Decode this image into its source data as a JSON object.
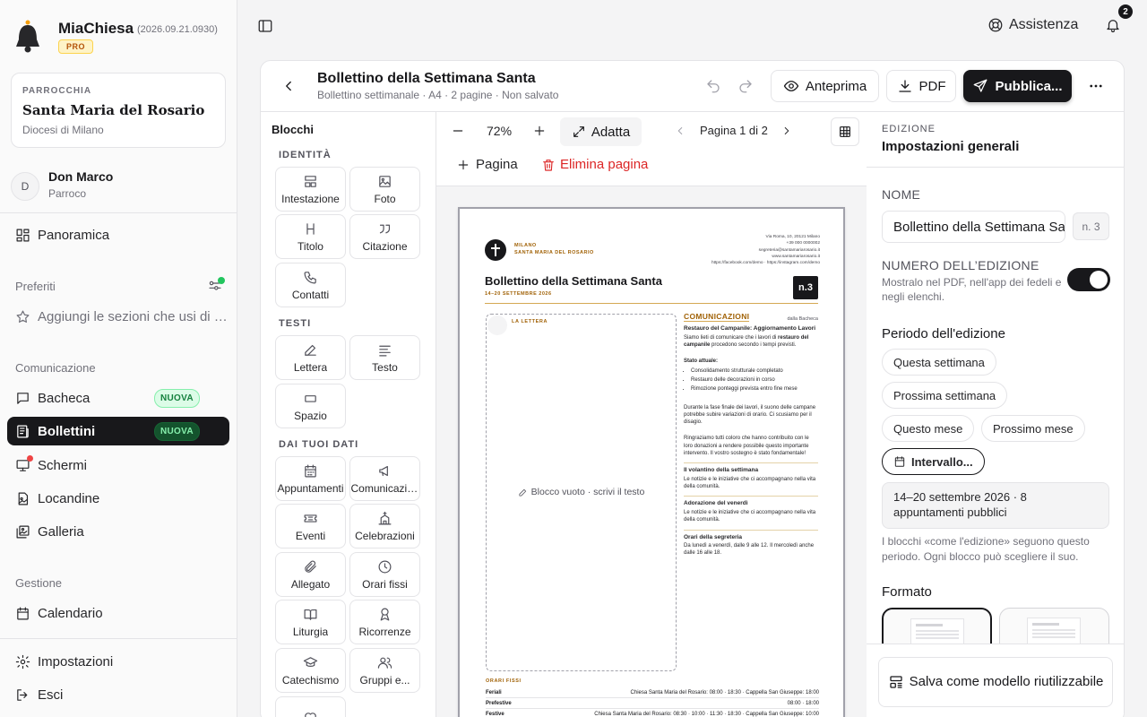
{
  "app": {
    "name": "MiaChiesa",
    "version": "(2026.09.21.0930)",
    "plan": "PRO"
  },
  "parish": {
    "kicker": "PARROCCHIA",
    "name": "Santa Maria del Rosario",
    "diocese": "Diocesi di Milano"
  },
  "user": {
    "initial": "D",
    "name": "Don Marco",
    "role": "Parroco"
  },
  "nav": {
    "overview": "Panoramica",
    "favorites_title": "Preferiti",
    "favorites_add": "Aggiungi le sezioni che usi di più",
    "communication_title": "Comunicazione",
    "bacheca": "Bacheca",
    "bollettini": "Bollettini",
    "schermi": "Schermi",
    "locandine": "Locandine",
    "galleria": "Galleria",
    "new_badge": "NUOVA",
    "management_title": "Gestione",
    "calendario": "Calendario",
    "impostazioni": "Impostazioni",
    "esci": "Esci"
  },
  "topbar": {
    "help": "Assistenza",
    "notifications": "2"
  },
  "editor": {
    "title": "Bollettino della Settimana Santa",
    "meta": "Bollettino settimanale  ·  A4  ·  2 pagine  ·  Non salvato",
    "preview": "Anteprima",
    "pdf": "PDF",
    "publish": "Pubblica..."
  },
  "blocks": {
    "title": "Blocchi",
    "groups": {
      "identity": "IDENTITÀ",
      "texts": "TESTI",
      "data": "DAI TUOI DATI"
    },
    "items": [
      "Intestazione",
      "Foto",
      "Titolo",
      "Citazione",
      "Contatti",
      "Lettera",
      "Testo",
      "Spazio",
      "Appuntamenti",
      "Comunicazioni",
      "Eventi",
      "Celebrazioni",
      "Allegato",
      "Orari fissi",
      "Liturgia",
      "Ricorrenze",
      "Catechismo",
      "Gruppi e..."
    ]
  },
  "canvas": {
    "zoom": "72%",
    "fit": "Adatta",
    "page_indicator": "Pagina 1 di 2",
    "add_page": "Pagina",
    "delete_page": "Elimina pagina"
  },
  "paper": {
    "city": "MILANO",
    "parish": "SANTA MARIA DEL ROSARIO",
    "contact": [
      "Via Roma, 10, 20121 Milano",
      "+39 000 0000002",
      "segreteria@santamariarosario.it",
      "www.santamariarosario.it",
      "https://facebook.com/demo · https://instagram.com/demo"
    ],
    "title": "Bollettino della Settimana Santa",
    "date": "14–20 SETTEMBRE 2026",
    "number": "n.3",
    "letter_label": "LA LETTERA",
    "empty_block": "Blocco vuoto · scrivi il testo",
    "comm_head": "COMUNICAZIONI",
    "comm_from": "dalla Bacheca",
    "article1_title": "Restauro del Campanile: Aggiornamento Lavori",
    "article1_p1_a": "Siamo lieti di comunicare che i lavori di ",
    "article1_p1_b": "restauro del campanile",
    "article1_p1_c": " procedono secondo i tempi previsti.",
    "article1_status": "Stato attuale:",
    "article1_list": [
      "Consolidamento strutturale completato",
      "Restauro delle decorazioni in corso",
      "Rimozione ponteggi prevista entro fine mese"
    ],
    "article1_p2": "Durante la fase finale dei lavori, il suono delle campane potrebbe subire variazioni di orario. Ci scusiamo per il disagio.",
    "article1_p3": "Ringraziamo tutti coloro che hanno contribuito con le loro donazioni a rendere possibile questo importante intervento. Il vostro sostegno è stato fondamentale!",
    "article2_title": "Il volantino della settimana",
    "article2_text": "Le notizie e le iniziative che ci accompagnano nella vita della comunità.",
    "article3_title": "Adorazione del venerdì",
    "article3_text": "Le notizie e le iniziative che ci accompagnano nella vita della comunità.",
    "article4_title": "Orari della segreteria",
    "article4_text": "Da lunedì a venerdì, dalle 9 alle 12. Il mercoledì anche dalle 16 alle 18.",
    "fixed_head": "ORARI FISSI",
    "fixed_rows": [
      {
        "label": "Feriali",
        "value": "Chiesa Santa Maria del Rosario: 08:00 · 18:30 · Cappella San Giuseppe: 18:00"
      },
      {
        "label": "Prefestive",
        "value": "08:00 · 18:00"
      },
      {
        "label": "Festive",
        "value": "Chiesa Santa Maria del Rosario: 08:30 · 10:00 · 11:30 · 18:30 · Cappella San Giuseppe: 10:00"
      }
    ]
  },
  "settings": {
    "kicker": "EDIZIONE",
    "title": "Impostazioni generali",
    "name_label": "NOME",
    "name_value": "Bollettino della Settimana Santa",
    "name_suffix": "n. 3",
    "edition_label": "NUMERO DELL’EDIZIONE",
    "edition_help": "Mostralo nel PDF, nell'app dei fedeli e negli elenchi.",
    "period_title": "Periodo dell'edizione",
    "chips": [
      "Questa settimana",
      "Prossima settimana",
      "Questo mese",
      "Prossimo mese",
      "Intervallo..."
    ],
    "period_summary": "14–20 settembre 2026 · 8 appuntamenti pubblici",
    "period_help": "I blocchi «come l'edizione» seguono questo periodo. Ogni blocco può scegliere il suo.",
    "format_title": "Formato",
    "save_template": "Salva come modello riutilizzabile"
  },
  "colors": {
    "accent": "#18181b",
    "gold": "#a16207",
    "new_badge": "#15803d",
    "danger": "#dc2626"
  }
}
